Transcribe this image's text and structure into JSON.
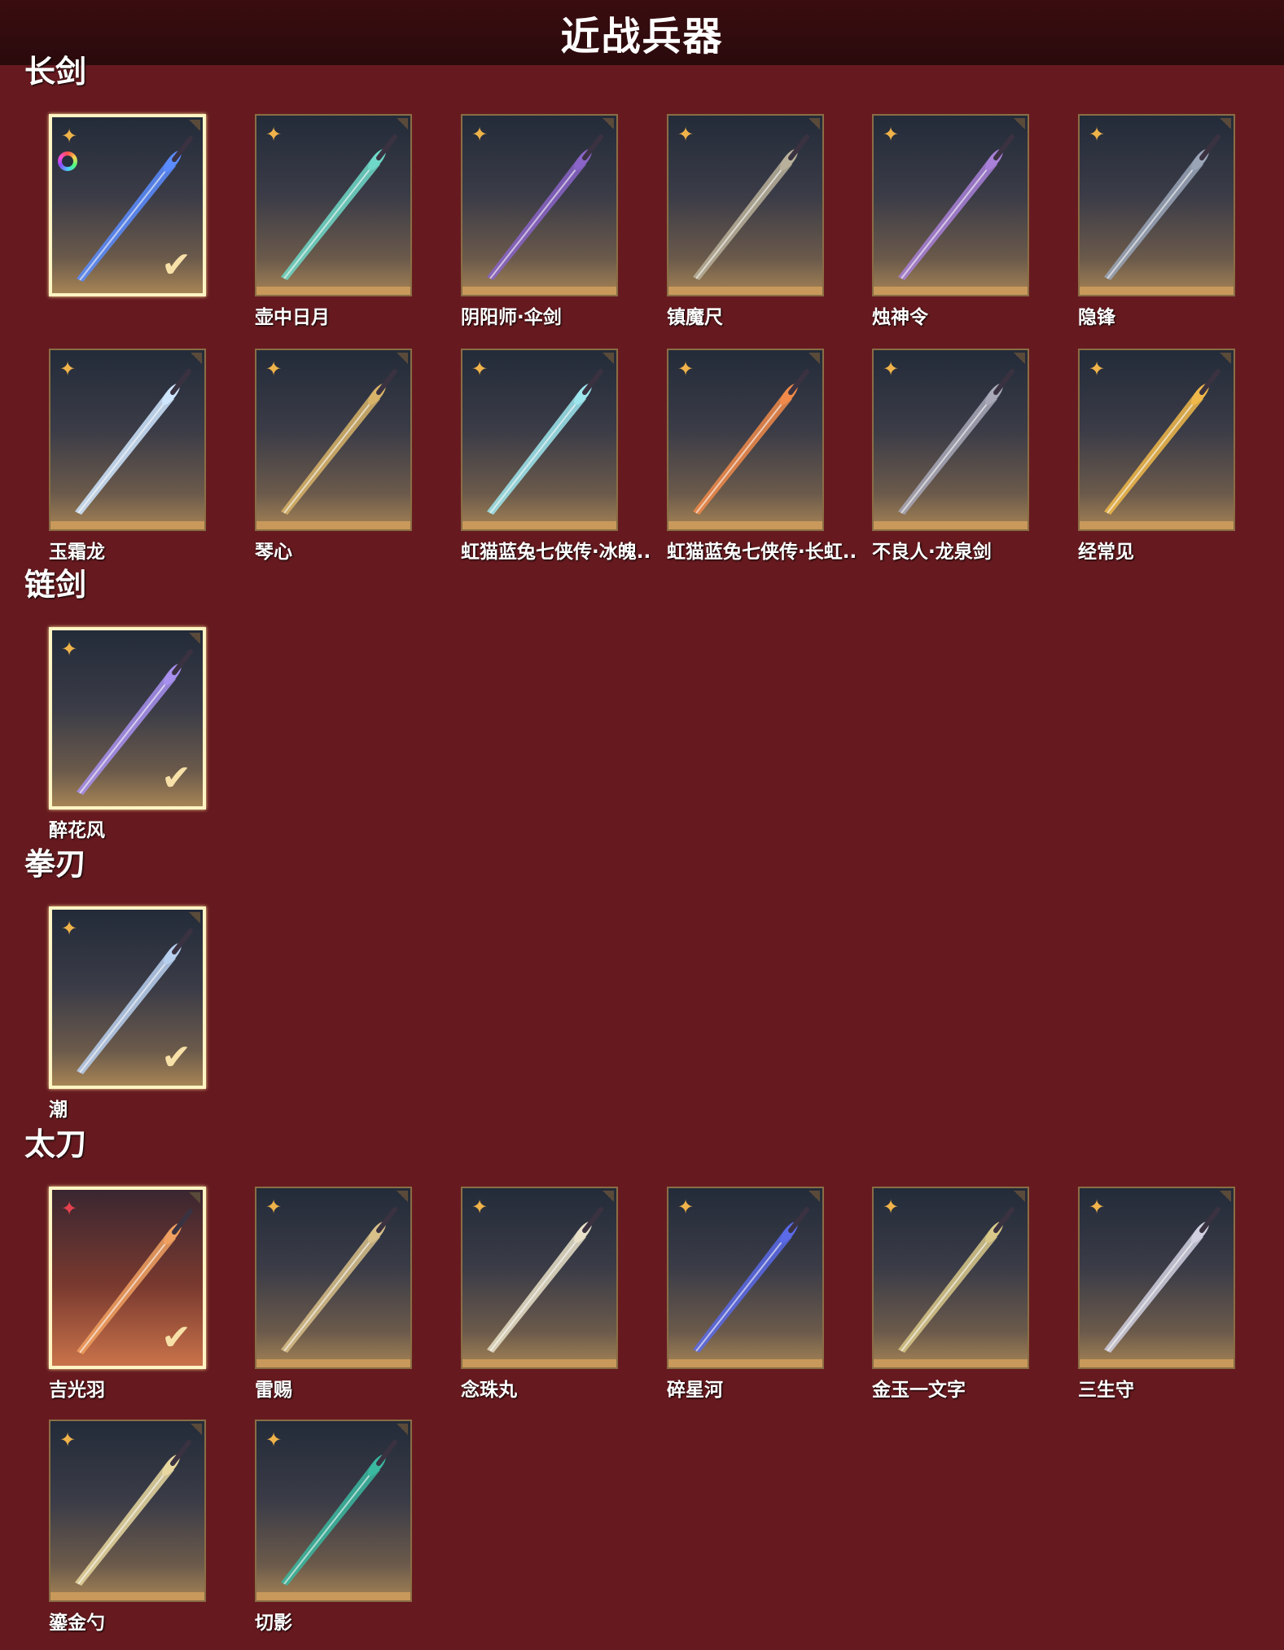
{
  "title": "近战兵器",
  "sections": [
    {
      "title": "长剑",
      "items": [
        {
          "name": "",
          "selected": true,
          "weapon_color": "#5b8cff"
        },
        {
          "name": "壶中日月",
          "weapon_color": "#6fd8c8"
        },
        {
          "name": "阴阳师·伞剑",
          "weapon_color": "#8a64c8"
        },
        {
          "name": "镇魔尺",
          "weapon_color": "#b8b09a"
        },
        {
          "name": "烛神令",
          "weapon_color": "#a880d8"
        },
        {
          "name": "隐锋",
          "weapon_color": "#9aa6b8"
        },
        {
          "name": "玉霜龙",
          "weapon_color": "#cfe6ff"
        },
        {
          "name": "琴心",
          "weapon_color": "#d8b46a"
        },
        {
          "name": "虹猫蓝兔七侠传·冰魄..",
          "weapon_color": "#9ee6ee"
        },
        {
          "name": "虹猫蓝兔七侠传·长虹..",
          "weapon_color": "#f08a4a"
        },
        {
          "name": "不良人·龙泉剑",
          "weapon_color": "#a8a8b8"
        },
        {
          "name": "经常见",
          "weapon_color": "#f0b84a"
        }
      ]
    },
    {
      "title": "链剑",
      "items": [
        {
          "name": "醉花风",
          "selected": true,
          "weapon_color": "#a890f0"
        }
      ]
    },
    {
      "title": "拳刃",
      "items": [
        {
          "name": "潮",
          "selected": true,
          "weapon_color": "#b8d0f0"
        }
      ]
    },
    {
      "title": "太刀",
      "items": [
        {
          "name": "吉光羽",
          "selected": true,
          "red": true,
          "weapon_color": "#f0a060"
        },
        {
          "name": "雷赐",
          "weapon_color": "#d8c08a"
        },
        {
          "name": "念珠丸",
          "weapon_color": "#e8e0c8"
        },
        {
          "name": "碎星河",
          "weapon_color": "#5a6ae8"
        },
        {
          "name": "金玉一文字",
          "weapon_color": "#d8c88a"
        },
        {
          "name": "三生守",
          "weapon_color": "#d0d0e0"
        },
        {
          "name": "鎏金勺",
          "weapon_color": "#e8d8a0"
        },
        {
          "name": "切影",
          "weapon_color": "#3ab8a0"
        }
      ]
    }
  ],
  "icons": {
    "star": "four-point-star-icon",
    "check": "check-icon",
    "ring": "rainbow-ring-icon"
  },
  "colors": {
    "background": "#661a1f",
    "header": "#2e0b0e",
    "accent": "#f0b34a"
  }
}
